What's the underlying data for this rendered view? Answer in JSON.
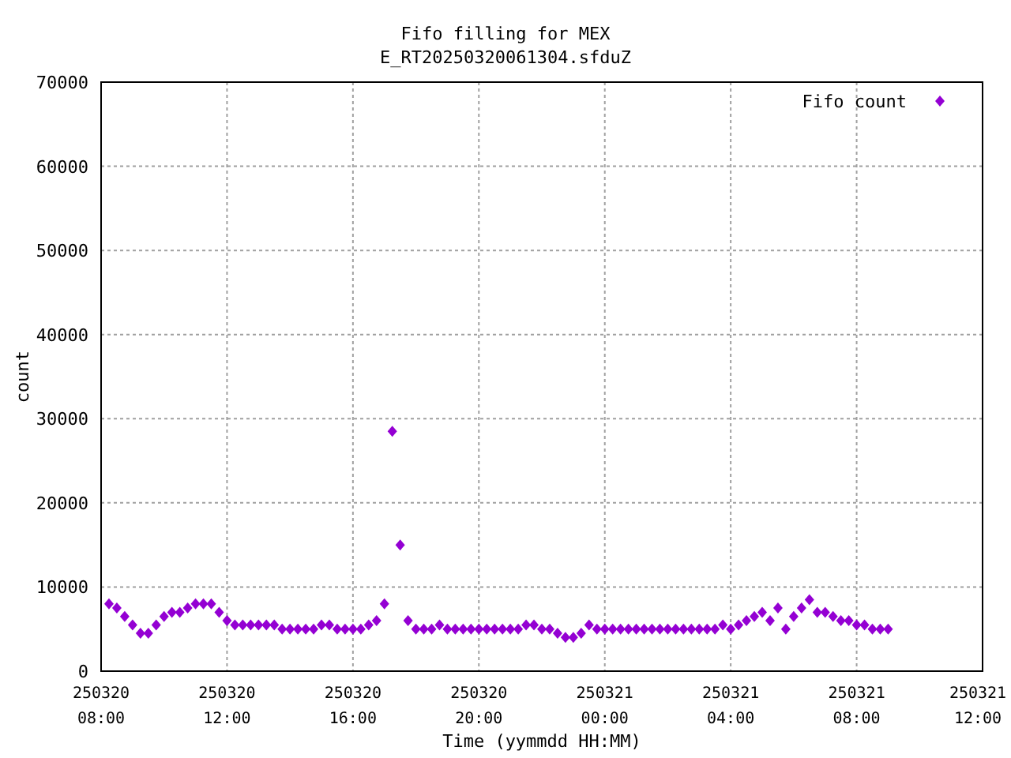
{
  "chart_data": {
    "type": "scatter",
    "title": "Fifo filling for MEX",
    "subtitle": "E_RT20250320061304.sfduZ",
    "xlabel": "Time (yymmdd HH:MM)",
    "ylabel": "count",
    "grid": true,
    "ylim": [
      0,
      70000
    ],
    "yticks": [
      0,
      10000,
      20000,
      30000,
      40000,
      50000,
      60000,
      70000
    ],
    "categories": [
      "250320 08:00",
      null,
      null,
      null,
      null,
      null,
      null,
      null,
      null,
      null,
      null,
      null,
      null,
      null,
      null,
      null,
      "250320 12:00",
      null,
      null,
      null,
      null,
      null,
      null,
      null,
      null,
      null,
      null,
      null,
      null,
      null,
      null,
      null,
      "250320 16:00",
      null,
      null,
      null,
      null,
      null,
      null,
      null,
      null,
      null,
      null,
      null,
      null,
      null,
      null,
      null,
      "250320 20:00",
      null,
      null,
      null,
      null,
      null,
      null,
      null,
      null,
      null,
      null,
      null,
      null,
      null,
      null,
      null,
      "250321 00:00",
      null,
      null,
      null,
      null,
      null,
      null,
      null,
      null,
      null,
      null,
      null,
      null,
      null,
      null,
      null,
      "250321 04:00",
      null,
      null,
      null,
      null,
      null,
      null,
      null,
      null,
      null,
      null,
      null,
      null,
      null,
      null,
      null,
      "250321 08:00",
      null,
      null,
      null,
      null,
      null,
      null,
      null,
      null,
      null,
      null,
      null,
      null,
      null,
      null,
      null,
      "250321 12:00"
    ],
    "series": [
      {
        "name": "Fifo count",
        "color": "#9400d3",
        "values": [
          null,
          8000,
          7500,
          6500,
          5500,
          4500,
          4500,
          5500,
          6500,
          7000,
          7000,
          7500,
          8000,
          8000,
          8000,
          7000,
          6000,
          5500,
          5500,
          5500,
          5500,
          5500,
          5500,
          5000,
          5000,
          5000,
          5000,
          5000,
          5500,
          5500,
          5000,
          5000,
          5000,
          5000,
          5500,
          6000,
          8000,
          28500,
          15000,
          6000,
          5000,
          5000,
          5000,
          5500,
          5000,
          5000,
          5000,
          5000,
          5000,
          5000,
          5000,
          5000,
          5000,
          5000,
          5500,
          5500,
          5000,
          5000,
          4500,
          4000,
          4000,
          4500,
          5500,
          5000,
          5000,
          5000,
          5000,
          5000,
          5000,
          5000,
          5000,
          5000,
          5000,
          5000,
          5000,
          5000,
          5000,
          5000,
          5000,
          5500,
          5000,
          5500,
          6000,
          6500,
          7000,
          6000,
          7500,
          5000,
          6500,
          7500,
          8500,
          7000,
          7000,
          6500,
          6000,
          6000,
          5500,
          5500,
          5000,
          5000,
          5000,
          null,
          null,
          null,
          null,
          null,
          null,
          null,
          null,
          null,
          null,
          null,
          null
        ]
      }
    ]
  }
}
